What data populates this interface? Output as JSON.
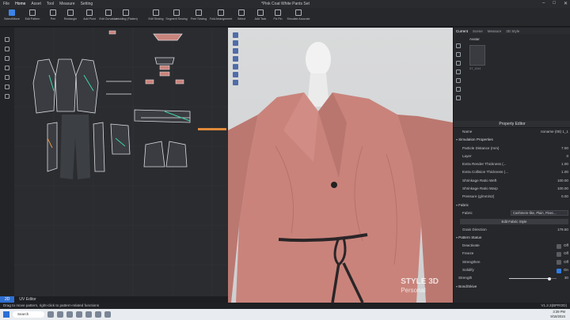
{
  "titlebar": {
    "menu": [
      "File",
      "Home",
      "Asset",
      "Tool",
      "Measure",
      "Setting"
    ],
    "active_menu": "Home",
    "document_title": "*Pink Coat White Pants Set"
  },
  "toolbar": {
    "tools": [
      {
        "name": "select-move-tool",
        "label": "Select/Move",
        "active": true
      },
      {
        "name": "edit-pattern-tool",
        "label": "Edit Pattern"
      },
      {
        "name": "pen-tool",
        "label": "Pen"
      },
      {
        "name": "rectangle-tool",
        "label": "Rectangle"
      },
      {
        "name": "add-point-tool",
        "label": "Add Point"
      },
      {
        "name": "edit-curve-point-tool",
        "label": "Edit Curvature"
      },
      {
        "name": "unfold-tool",
        "label": "Unfolding (Flatten)"
      },
      {
        "name": "edit-sewing-tool",
        "label": "Edit Sewing"
      },
      {
        "name": "segment-sewing-tool",
        "label": "Segment Sewing"
      },
      {
        "name": "free-sewing-tool",
        "label": "Free Sewing"
      },
      {
        "name": "fold-arrangement-tool",
        "label": "Fold Arrangement"
      },
      {
        "name": "select-3d-tool",
        "label": "Select"
      },
      {
        "name": "add-tack-tool",
        "label": "Add Tack"
      },
      {
        "name": "fix-pin-tool",
        "label": "Fix Pin"
      },
      {
        "name": "simulate-tool",
        "label": "Simulate Accurate"
      }
    ]
  },
  "tab2d": {
    "tab_2d": "2D",
    "tab_uv": "UV Editor"
  },
  "watermark": {
    "line1": "STYLE 3D",
    "line2": "Personal"
  },
  "right_panel": {
    "tabs": [
      "Current",
      "Scene",
      "Measure",
      "3D Style"
    ],
    "active_tab": "Current",
    "avatar_label": "Avatar",
    "thumb_caption": "ST_1044",
    "property_editor_title": "Property Editor",
    "rows": [
      {
        "type": "plain",
        "key": "Name",
        "value": "noname (08) 1_1"
      },
      {
        "type": "section",
        "key": "Simulation Properties"
      },
      {
        "type": "plain",
        "key": "Particle Distance (mm)",
        "value": "7.00"
      },
      {
        "type": "plain",
        "key": "Layer",
        "value": "0"
      },
      {
        "type": "plain",
        "key": "Extra Render Thickness (...",
        "value": "1.00"
      },
      {
        "type": "plain",
        "key": "Extra Collision Thickness (...",
        "value": "1.00"
      },
      {
        "type": "plain",
        "key": "Shrinkage Ratio Weft",
        "value": "100.00"
      },
      {
        "type": "plain",
        "key": "Shrinkage Ratio Warp",
        "value": "100.00"
      },
      {
        "type": "plain",
        "key": "Pressure (g/mm/s2)",
        "value": "0.00"
      },
      {
        "type": "section",
        "key": "Fabric"
      },
      {
        "type": "field",
        "key": "Fabric",
        "value": "Cashmere-like, Plain, Fleec..."
      },
      {
        "type": "button",
        "key": "Edit Fabric Style"
      },
      {
        "type": "plain",
        "key": "Grain Direction",
        "value": "179.50"
      },
      {
        "type": "section",
        "key": "Pattern Status"
      },
      {
        "type": "toggle",
        "key": "Deactivate",
        "value": "Off",
        "on": false
      },
      {
        "type": "toggle",
        "key": "Freeze",
        "value": "Off",
        "on": false
      },
      {
        "type": "toggle",
        "key": "Strengthen",
        "value": "Off",
        "on": false
      },
      {
        "type": "toggle",
        "key": "Solidify",
        "value": "On",
        "on": true
      },
      {
        "type": "slider",
        "key": "Strength",
        "value": "30",
        "fraction": 0.85
      },
      {
        "type": "section",
        "key": "Bond/Skive"
      }
    ]
  },
  "statusbar": {
    "message": "Drag to move pattern, right-click to pattern-related functions",
    "version": "V1.2.3(BPROD)"
  },
  "taskbar": {
    "search_placeholder": "Search",
    "time": "3:39 PM",
    "date": "9/16/2024"
  },
  "colors": {
    "accent": "#2f7de0",
    "garment": "#c9837b",
    "sash": "#2a2527"
  }
}
